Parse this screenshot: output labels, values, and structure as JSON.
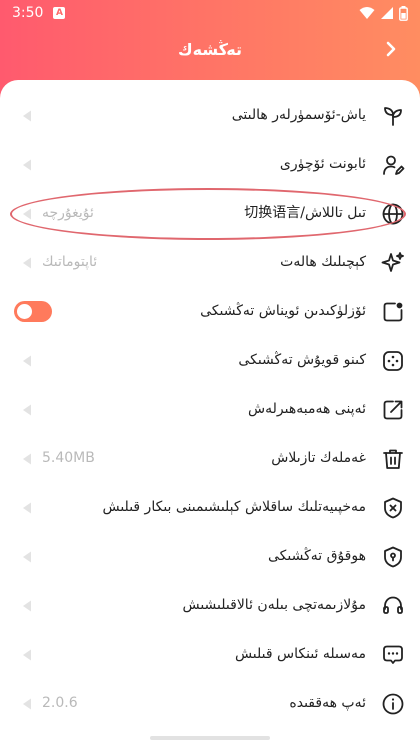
{
  "status": {
    "time": "3:50",
    "notice": "A"
  },
  "header": {
    "title": "تەڭشەك"
  },
  "rows": [
    {
      "label": "ياش-ئۆسمۈرلەر ھالىتى",
      "value": ""
    },
    {
      "label": "ئابونت ئۆچۈرى",
      "value": ""
    },
    {
      "label": "تىل تاللاش/切换语言",
      "value": "ئۇيغۇرچە"
    },
    {
      "label": "كېچىلىك ھالەت",
      "value": "ئاپتوماتىك"
    },
    {
      "label": "ئۆزلۈكىدىن ئويناش تەڭشىكى",
      "value": ""
    },
    {
      "label": "كىنو قويۇش تەڭشىكى",
      "value": ""
    },
    {
      "label": "ئەپنى ھەمبەھىرلەش",
      "value": ""
    },
    {
      "label": "غەملەك تازىلاش",
      "value": "5.40MB"
    },
    {
      "label": "مەخپىيەتلىك ساقلاش كېلىشىمىنى بىكار قىلىش",
      "value": ""
    },
    {
      "label": "ھوقۇق تەڭشىكى",
      "value": ""
    },
    {
      "label": "مۇلازىمەتچى بىلەن ئالاقىلىشىش",
      "value": ""
    },
    {
      "label": "مەسىلە ئىنكاس قىلىش",
      "value": ""
    },
    {
      "label": "ئەپ ھەققىدە",
      "value": "2.0.6"
    }
  ],
  "toggle": {
    "on": true
  },
  "icons": [
    "sprout-icon",
    "user-edit-icon",
    "globe-icon",
    "sparkle-icon",
    "square-dot-icon",
    "gamepad-icon",
    "share-arrow-icon",
    "trash-icon",
    "shield-x-icon",
    "shield-keyhole-icon",
    "headset-icon",
    "chat-dots-icon",
    "info-icon"
  ]
}
